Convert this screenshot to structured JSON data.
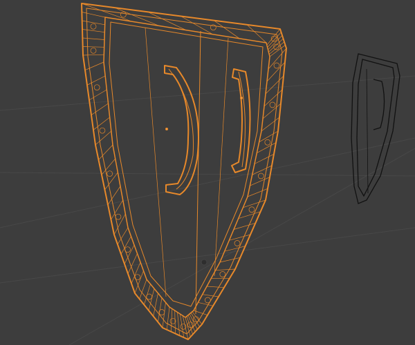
{
  "viewport": {
    "background_color": "#3d3d3d",
    "grid_color": "#4a4a4a",
    "selected_wire_color": "#e8892a",
    "selected_wire_light": "#f2a04a",
    "unselected_wire_color": "#111111"
  },
  "objects": [
    {
      "name": "shield-selected",
      "selected": true
    },
    {
      "name": "shield-copy",
      "selected": false
    }
  ]
}
